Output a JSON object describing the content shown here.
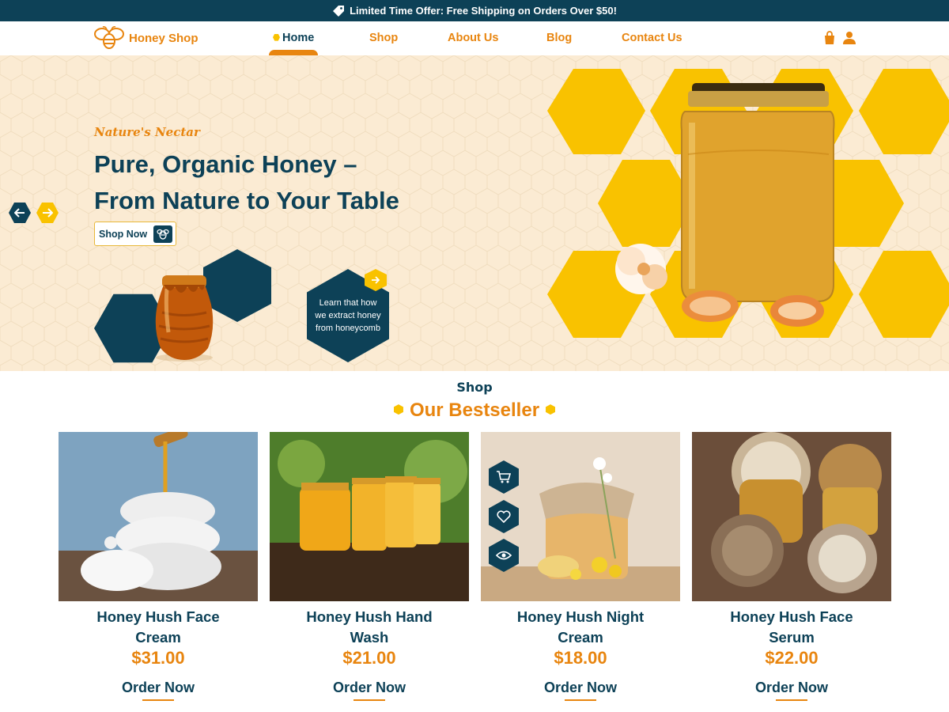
{
  "topbar": {
    "offer": "Limited Time Offer: Free Shipping on Orders Over $50!"
  },
  "header": {
    "logo_text": "Honey Shop",
    "nav": [
      "Home",
      "Shop",
      "About Us",
      "Blog",
      "Contact Us"
    ],
    "active": "Home"
  },
  "hero": {
    "subtitle": "Nature's Nectar",
    "title_line1": "Pure, Organic Honey –",
    "title_line2": "From Nature to Your Table",
    "cta": "Shop Now",
    "learn_text": "Learn that how we extract honey from honeycomb"
  },
  "section": {
    "small": "Shop",
    "big": "Our Bestseller"
  },
  "products": [
    {
      "name": "Honey Hush Face Cream",
      "price": "$31.00",
      "cta": "Order Now"
    },
    {
      "name": "Honey Hush Hand Wash",
      "price": "$21.00",
      "cta": "Order Now"
    },
    {
      "name": "Honey Hush Night Cream",
      "price": "$18.00",
      "cta": "Order Now"
    },
    {
      "name": "Honey Hush Face Serum",
      "price": "$22.00",
      "cta": "Order Now"
    }
  ],
  "colors": {
    "navy": "#0d4157",
    "orange": "#e8850f",
    "yellow": "#f9c200",
    "cream": "#fbebd3"
  }
}
